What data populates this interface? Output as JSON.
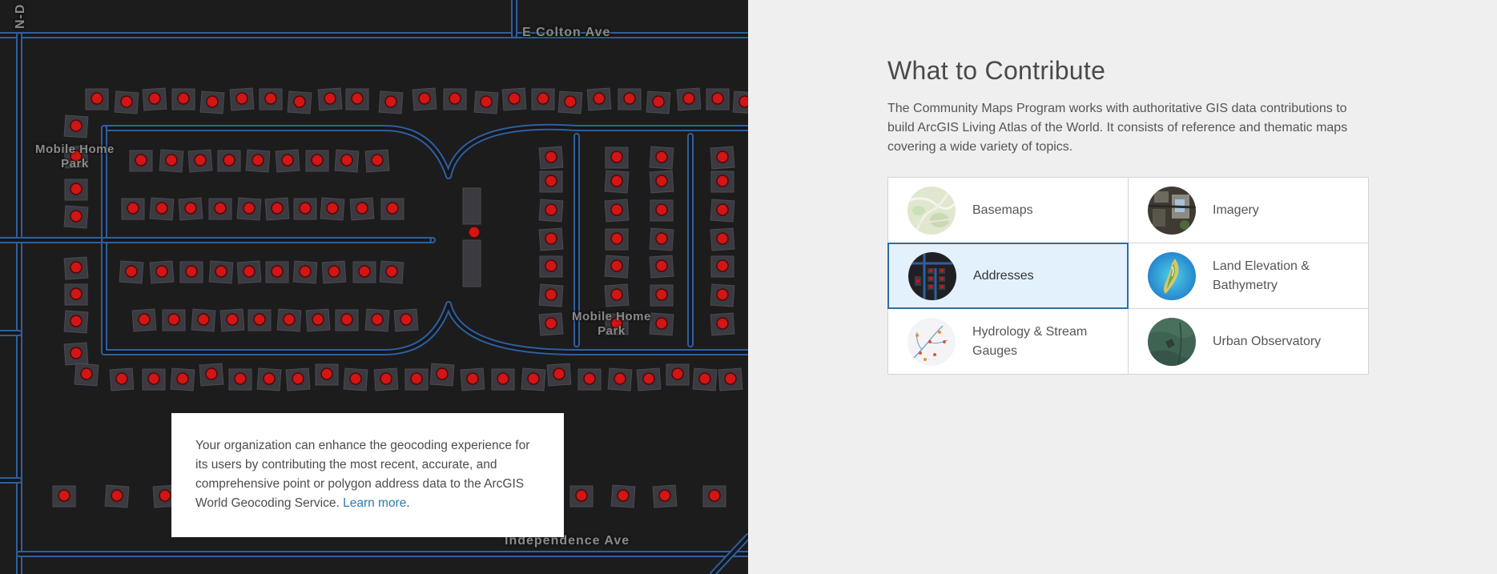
{
  "map": {
    "street_labels": {
      "top_street": "E Colton Ave",
      "bottom_street": "Independence Ave",
      "vertical_street": "N-D",
      "area_left_line1": "Mobile Home",
      "area_left_line2": "Park",
      "area_right_line1": "Mobile Home",
      "area_right_line2": "Park"
    },
    "colors": {
      "background": "#1c1c1c",
      "road_casing": "#2f5f9e",
      "parcel": "#3a3a40",
      "address_point": "#d21515"
    }
  },
  "info_card": {
    "text": "Your organization can enhance the geocoding experience for its users by contributing the most recent, accurate, and comprehensive point or polygon address data to the ArcGIS World Geocoding Service. ",
    "link_text": "Learn more",
    "trailing": "."
  },
  "section": {
    "title": "What to Contribute",
    "description": "The Community Maps Program works with authoritative GIS data contributions to build ArcGIS Living Atlas of the World. It consists of reference and thematic maps covering a wide variety of topics."
  },
  "categories": [
    {
      "label": "Basemaps",
      "icon": "basemaps-thumbnail-icon",
      "selected": false
    },
    {
      "label": "Imagery",
      "icon": "imagery-thumbnail-icon",
      "selected": false
    },
    {
      "label": "Addresses",
      "icon": "addresses-thumbnail-icon",
      "selected": true
    },
    {
      "label": "Land Elevation & Bathymetry",
      "icon": "elevation-thumbnail-icon",
      "selected": false
    },
    {
      "label": "Hydrology & Stream Gauges",
      "icon": "hydrology-thumbnail-icon",
      "selected": false
    },
    {
      "label": "Urban Observatory",
      "icon": "urban-thumbnail-icon",
      "selected": false
    }
  ],
  "accent_color": "#2b6ea5"
}
